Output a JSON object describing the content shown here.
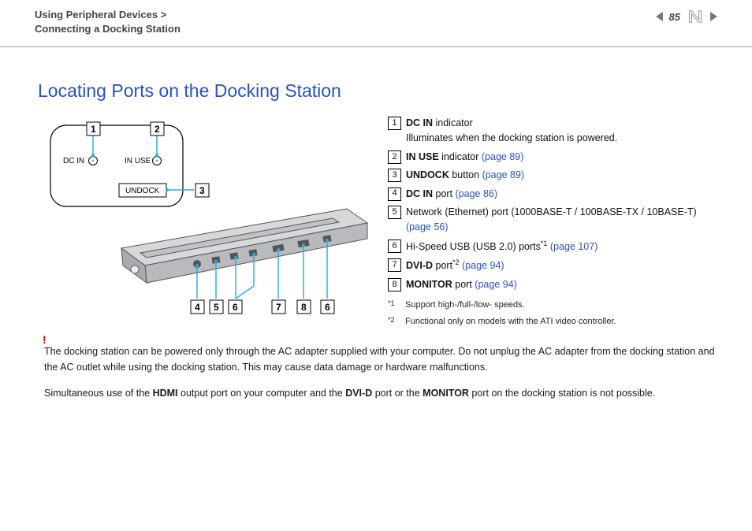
{
  "header": {
    "crumb_line1": "Using Peripheral Devices >",
    "crumb_line2": "Connecting a Docking Station",
    "page_number": "85"
  },
  "title": "Locating Ports on the Docking Station",
  "figure": {
    "top_label_dcin": "DC IN",
    "top_label_inuse": "IN USE",
    "top_label_undock": "UNDOCK",
    "callouts_top": [
      "1",
      "2",
      "3"
    ],
    "callouts_bottom": [
      "4",
      "5",
      "6",
      "7",
      "8",
      "6"
    ]
  },
  "legend": {
    "items": [
      {
        "n": "1",
        "bold": "DC IN",
        "rest": " indicator",
        "line2": "Illuminates when the docking station is powered."
      },
      {
        "n": "2",
        "bold": "IN USE",
        "rest": " indicator ",
        "link": "(page 89)"
      },
      {
        "n": "3",
        "bold": "UNDOCK",
        "rest": " button ",
        "link": "(page 89)"
      },
      {
        "n": "4",
        "bold": "DC IN",
        "rest": " port ",
        "link": "(page 86)"
      },
      {
        "n": "5",
        "plain": "Network (Ethernet) port (1000BASE-T / 100BASE-TX / 10BASE-T) ",
        "link": "(page 56)"
      },
      {
        "n": "6",
        "plain": "Hi-Speed USB (USB 2.0) ports",
        "sup": "*1",
        "post": " ",
        "link": "(page 107)"
      },
      {
        "n": "7",
        "bold": "DVI-D",
        "rest": " port",
        "sup": "*2",
        "post": " ",
        "link": "(page 94)"
      },
      {
        "n": "8",
        "bold": "MONITOR",
        "rest": " port ",
        "link": "(page 94)"
      }
    ],
    "footnotes": [
      {
        "mark": "*1",
        "text": "Support high-/full-/low- speeds."
      },
      {
        "mark": "*2",
        "text": "Functional only on models with the ATI video controller."
      }
    ]
  },
  "notices": {
    "bang": "!",
    "n1": "The docking station can be powered only through the AC adapter supplied with your computer. Do not unplug the AC adapter from the docking station and the AC outlet while using the docking station. This may cause data damage or hardware malfunctions.",
    "n2_pre": "Simultaneous use of the ",
    "n2_b1": "HDMI",
    "n2_mid1": " output port on your computer and the ",
    "n2_b2": "DVI-D",
    "n2_mid2": " port or the ",
    "n2_b3": "MONITOR",
    "n2_end": " port on the docking station is not possible."
  }
}
